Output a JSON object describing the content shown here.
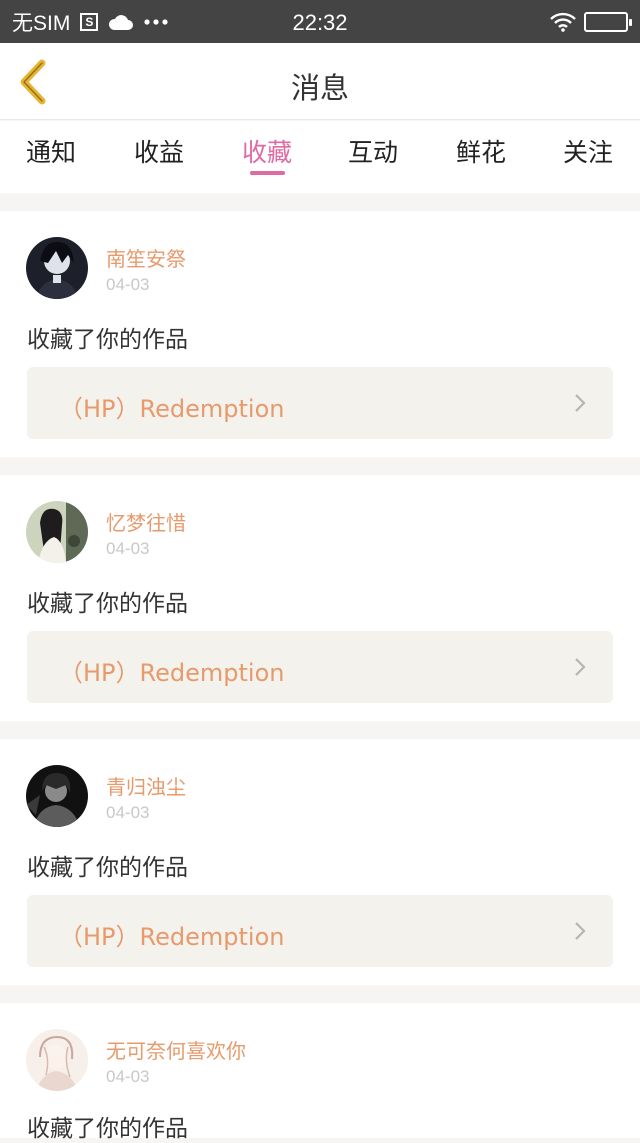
{
  "status_bar": {
    "carrier": "无SIM",
    "sim_icon_text": "S",
    "time": "22:32"
  },
  "header": {
    "title": "消息"
  },
  "tabs": [
    "通知",
    "收益",
    "收藏",
    "互动",
    "鲜花",
    "关注"
  ],
  "active_tab": "收藏",
  "colors": {
    "accent": "#e06aa3",
    "username": "#e79a6c",
    "work_bg": "#f3f2ec",
    "back_arrow": "#e8b532"
  },
  "messages": [
    {
      "username": "南笙安祭",
      "date": "04-03",
      "action": "收藏了你的作品",
      "work_title": "（HP）Redemption"
    },
    {
      "username": "忆梦往惜",
      "date": "04-03",
      "action": "收藏了你的作品",
      "work_title": "（HP）Redemption"
    },
    {
      "username": "青归浊尘",
      "date": "04-03",
      "action": "收藏了你的作品",
      "work_title": "（HP）Redemption"
    },
    {
      "username": "无可奈何喜欢你",
      "date": "04-03",
      "action": "收藏了你的作品"
    }
  ]
}
